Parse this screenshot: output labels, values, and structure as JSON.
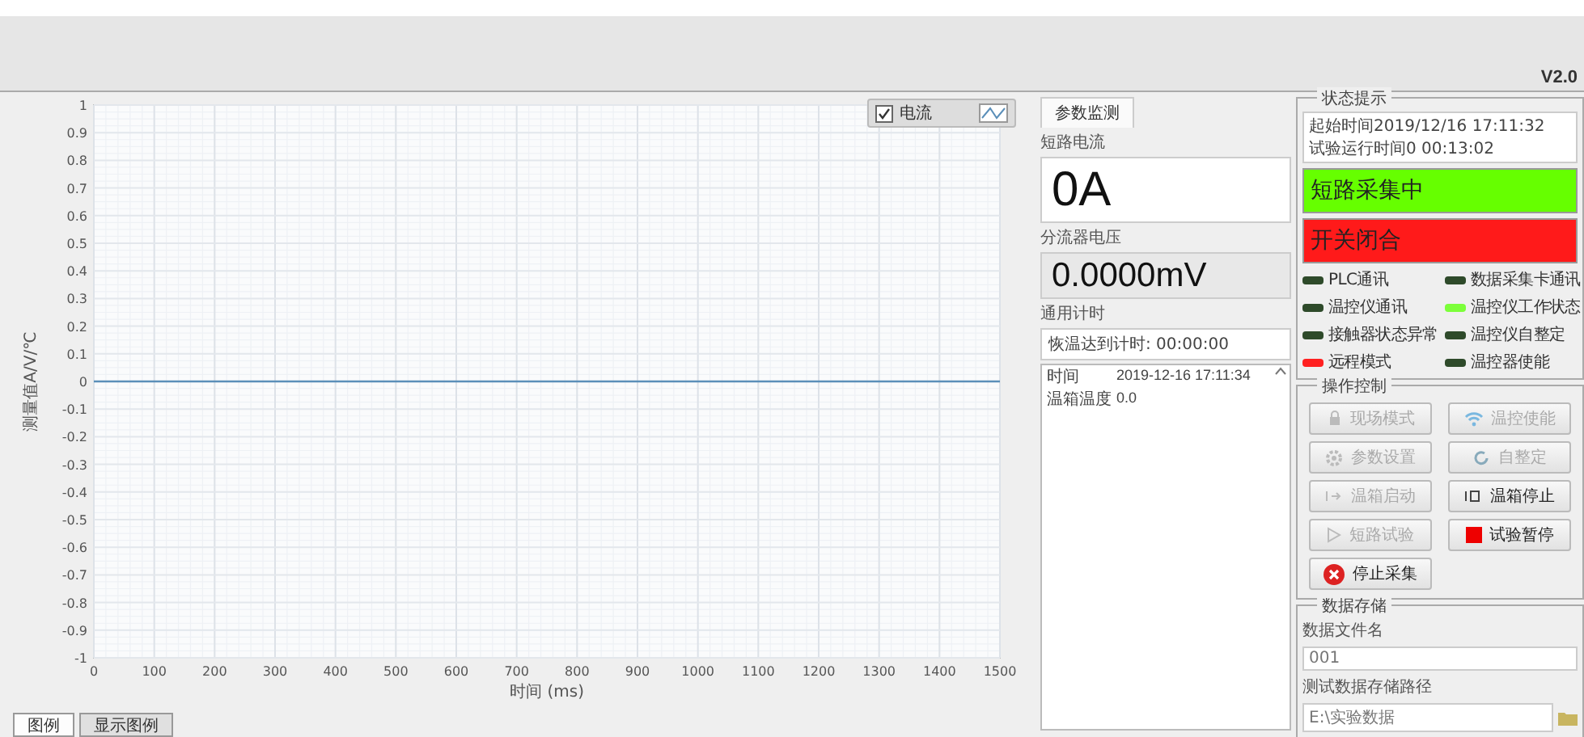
{
  "header": {
    "version": "V2.0"
  },
  "chart": {
    "chart_data": {
      "type": "line",
      "grid": true,
      "ylabel": "测量值A/V/℃",
      "xlabel": "时间 (ms)",
      "x": [
        0,
        1500
      ],
      "series": [
        {
          "name": "电流",
          "color": "#5b8fb9",
          "values": [
            0,
            0
          ]
        }
      ],
      "xlim": [
        0,
        1500
      ],
      "ylim": [
        -1,
        1
      ],
      "xticks": [
        0,
        100,
        200,
        300,
        400,
        500,
        600,
        700,
        800,
        900,
        1000,
        1100,
        1200,
        1300,
        1400,
        1500
      ],
      "yticks": [
        -1,
        -0.9,
        -0.8,
        -0.7,
        -0.6,
        -0.5,
        -0.4,
        -0.3,
        -0.2,
        -0.1,
        0,
        0.1,
        0.2,
        0.3,
        0.4,
        0.5,
        0.6,
        0.7,
        0.8,
        0.9,
        1
      ]
    },
    "legend": {
      "checked": true
    },
    "tabs": [
      {
        "label": "图例",
        "selected": true
      },
      {
        "label": "显示图例",
        "selected": false
      }
    ]
  },
  "monitor": {
    "tab": {
      "label": "参数监测",
      "selected": true
    },
    "current": {
      "label": "短路电流",
      "value": "0A"
    },
    "voltage": {
      "label": "分流器电压",
      "value": "0.0000mV"
    },
    "timer": {
      "label": "通用计时",
      "value": "恢温达到计时: 00:00:00"
    },
    "table": [
      {
        "name": "时间",
        "value": "2019-12-16 17:11:34"
      },
      {
        "name": "温箱温度",
        "value": "0.0"
      }
    ]
  },
  "status": {
    "title": "状态提示",
    "lines": [
      "起始时间2019/12/16 17:11:32",
      "试验运行时间0 00:13:02"
    ],
    "banners": [
      {
        "text": "短路采集中",
        "color": "#66ff00"
      },
      {
        "text": "开关闭合",
        "color": "#ff1a1a"
      }
    ],
    "leds": [
      {
        "label": "PLC通讯",
        "color": "#2e4a2a"
      },
      {
        "label": "数据采集卡通讯",
        "color": "#2e4a2a"
      },
      {
        "label": "温控仪通讯",
        "color": "#2e4a2a"
      },
      {
        "label": "温控仪工作状态",
        "color": "#7cff3a"
      },
      {
        "label": "接触器状态异常",
        "color": "#2e4a2a"
      },
      {
        "label": "温控仪自整定",
        "color": "#2e4a2a"
      },
      {
        "label": "远程模式",
        "color": "#ff2020"
      },
      {
        "label": "温控器使能",
        "color": "#2e4a2a"
      }
    ]
  },
  "control": {
    "title": "操作控制",
    "buttons": [
      {
        "label": "现场模式",
        "kind": "lock",
        "disabled": true
      },
      {
        "label": "温控使能",
        "kind": "wifi",
        "disabled": true
      },
      {
        "label": "参数设置",
        "kind": "gear",
        "disabled": true
      },
      {
        "label": "自整定",
        "kind": "refresh",
        "disabled": true
      },
      {
        "label": "温箱启动",
        "kind": "start",
        "disabled": true
      },
      {
        "label": "温箱停止",
        "kind": "stop",
        "disabled": false
      },
      {
        "label": "短路试验",
        "kind": "play",
        "disabled": true
      },
      {
        "label": "试验暂停",
        "kind": "square",
        "disabled": false
      },
      {
        "label": "停止采集",
        "kind": "cancel",
        "disabled": false
      }
    ]
  },
  "storage": {
    "title": "数据存储",
    "file_label": "数据文件名",
    "file_value": "001",
    "path_label": "测试数据存储路径",
    "path_value": "E:\\实验数据"
  }
}
